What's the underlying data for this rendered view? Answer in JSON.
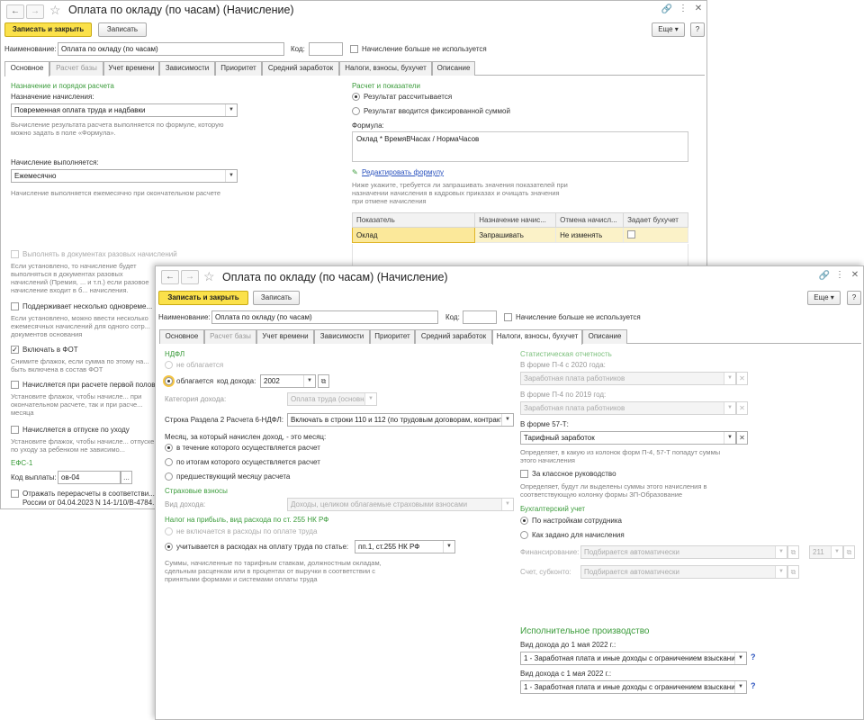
{
  "back_window": {
    "title": "Оплата по окладу (по часам) (Начисление)",
    "toolbar": {
      "save_close": "Записать и закрыть",
      "save": "Записать",
      "more": "Еще",
      "help": "?"
    },
    "name_label": "Наименование:",
    "name_value": "Оплата по окладу (по часам)",
    "code_label": "Код:",
    "not_used": "Начисление больше не используется",
    "tabs": [
      "Основное",
      "Расчет базы",
      "Учет времени",
      "Зависимости",
      "Приоритет",
      "Средний заработок",
      "Налоги, взносы, бухучет",
      "Описание"
    ],
    "left": {
      "purpose_title": "Назначение и порядок расчета",
      "purpose_label": "Назначение начисления:",
      "purpose_value": "Повременная оплата труда и надбавки",
      "purpose_hint": "Вычисление результата расчета выполняется по формуле, которую можно задать в поле «Формула».",
      "performed_label": "Начисление выполняется:",
      "performed_value": "Ежемесячно",
      "performed_hint": "Начисление выполняется ежемесячно при окончательном расчете",
      "one_time_label": "Выполнять в документах разовых начислений",
      "one_time_hint": "Если установлено, то начисление будет выполняться в документах разовых начислений (Премия, ... и т.п.) если разовое начисление входит в б... начисления.",
      "multi_label": "Поддерживает несколько одновреме...",
      "multi_hint": "Если установлено, можно ввести несколько ежемесячных начислений для одного сотр... документов основания",
      "fot_label": "Включать в ФОТ",
      "fot_hint": "Снимите флажок, если сумма по этому на... быть включена в состав ФОТ",
      "first_half_label": "Начисляется при расчете первой полов...",
      "first_half_hint": "Установите флажок, чтобы начисле... при окончательном расчете, так и при расче... месяца",
      "care_leave_label": "Начисляется в отпуске по уходу",
      "care_leave_hint": "Установите флажок, чтобы начисле... отпуске по уходу за ребенком не зависимо...",
      "efs_title": "ЕФС-1",
      "pay_code_label": "Код выплаты:",
      "pay_code_value": "ов-04",
      "recalc_label": "Отражать перерасчеты в соответстви...",
      "recalc_line2": "России от 04.04.2023 N 14-1/10/В-4784..."
    },
    "right": {
      "calc_title": "Расчет и показатели",
      "radio_calc": "Результат рассчитывается",
      "radio_fixed": "Результат вводится фиксированной суммой",
      "formula_label": "Формула:",
      "formula_value": "Оклад * ВремяВЧасах / НормаЧасов",
      "edit_formula": "Редактировать формулу",
      "indicators_hint": "Ниже укажите, требуется ли запрашивать значения показателей при назначении начисления в кадровых приказах и очищать значения при отмене начисления",
      "table_headers": [
        "Показатель",
        "Назначение начис...",
        "Отмена начисл...",
        "Задает бухучет"
      ],
      "table_row": [
        "Оклад",
        "Запрашивать",
        "Не изменять"
      ]
    }
  },
  "front_window": {
    "title": "Оплата по окладу (по часам) (Начисление)",
    "toolbar": {
      "save_close": "Записать и закрыть",
      "save": "Записать",
      "more": "Еще",
      "help": "?"
    },
    "name_label": "Наименование:",
    "name_value": "Оплата по окладу (по часам)",
    "code_label": "Код:",
    "not_used": "Начисление больше не используется",
    "tabs": [
      "Основное",
      "Расчет базы",
      "Учет времени",
      "Зависимости",
      "Приоритет",
      "Средний заработок",
      "Налоги, взносы, бухучет",
      "Описание"
    ],
    "ndfl": {
      "title": "НДФЛ",
      "not_taxed": "не облагается",
      "taxed": "облагается",
      "income_code_label": "код дохода:",
      "income_code_value": "2002",
      "income_category_label": "Категория дохода:",
      "income_category_value": "Оплата труда (основная н...",
      "row_label": "Строка Раздела 2 Расчета 6-НДФЛ:",
      "row_value": "Включать в строки 110 и 112 (по трудовым договорам, контракт",
      "month_label": "Месяц, за который начислен доход, - это месяц:",
      "month_options": [
        "в течение которого осуществляется расчет",
        "по итогам которого осуществляется расчет",
        "предшествующий месяцу расчета"
      ]
    },
    "insurance": {
      "title": "Страховые взносы",
      "kind_label": "Вид дохода:",
      "kind_value": "Доходы, целиком облагаемые страховыми взносами"
    },
    "profit_tax": {
      "title": "Налог на прибыль, вид расхода по ст. 255 НК РФ",
      "opt_not": "не включается в расходы по оплате труда",
      "opt_yes": "учитывается в расходах на оплату труда по статье:",
      "article_value": "пп.1, ст.255 НК РФ",
      "hint": "Суммы, начисленные по тарифным ставкам, должностным окладам, сдельным расценкам или в процентах от выручки в соответствии с принятыми формами и системами оплаты труда"
    },
    "stats": {
      "title": "Статистическая отчетность",
      "p4_2020_label": "В форме П-4 с 2020 года:",
      "p4_2020_value": "Заработная плата работников",
      "p4_2019_label": "В форме П-4 по 2019 год:",
      "p4_2019_value": "Заработная плата работников",
      "f57t_label": "В форме 57-Т:",
      "f57t_value": "Тарифный заработок",
      "f57t_hint": "Определяет, в какую из колонок форм П-4, 57-Т попадут суммы этого начисления",
      "class_label": "За классное руководство",
      "class_hint": "Определяет, будут ли выделены суммы этого начисления в соответствующую колонку формы ЗП-Образование"
    },
    "accounting": {
      "title": "Бухгалтерский учет",
      "opt_employee": "По настройкам сотрудника",
      "opt_accrual": "Как задано для начисления",
      "financing_label": "Финансирование:",
      "financing_value": "Подбирается автоматически",
      "financing_code": "211",
      "account_label": "Счет, субконто:",
      "account_value": "Подбирается автоматически"
    },
    "enforcement": {
      "title": "Исполнительное производство",
      "before_label": "Вид дохода до 1 мая 2022 г.:",
      "before_value": "1 - Заработная плата и иные доходы с ограничением взыскания",
      "after_label": "Вид дохода с 1 мая 2022 г.:",
      "after_value": "1 - Заработная плата и иные доходы с ограничением взыскания"
    }
  }
}
